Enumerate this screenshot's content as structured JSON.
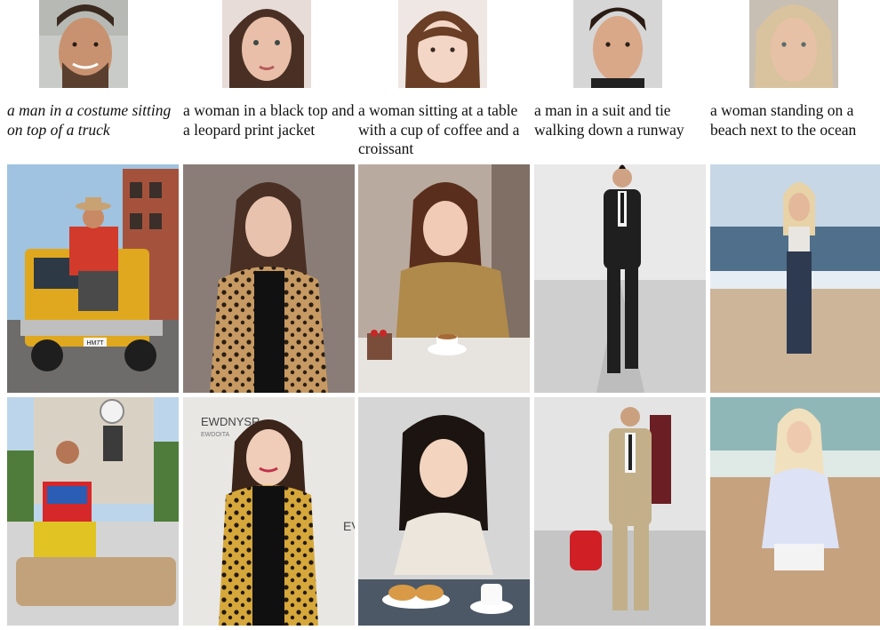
{
  "captions": [
    "a man in a costume sitting on top of a truck",
    "a woman in a black top and a leopard print jacket",
    "a woman sitting at a table with a cup of coffee and a croissant",
    "a man in a suit and tie walking down a runway",
    "a woman standing on a beach next to the ocean"
  ],
  "sign_text": {
    "plate": "HM7T",
    "backdrop_1": "EWDNYSR",
    "backdrop_2": "EWDOITA",
    "side_letters": "EV"
  }
}
